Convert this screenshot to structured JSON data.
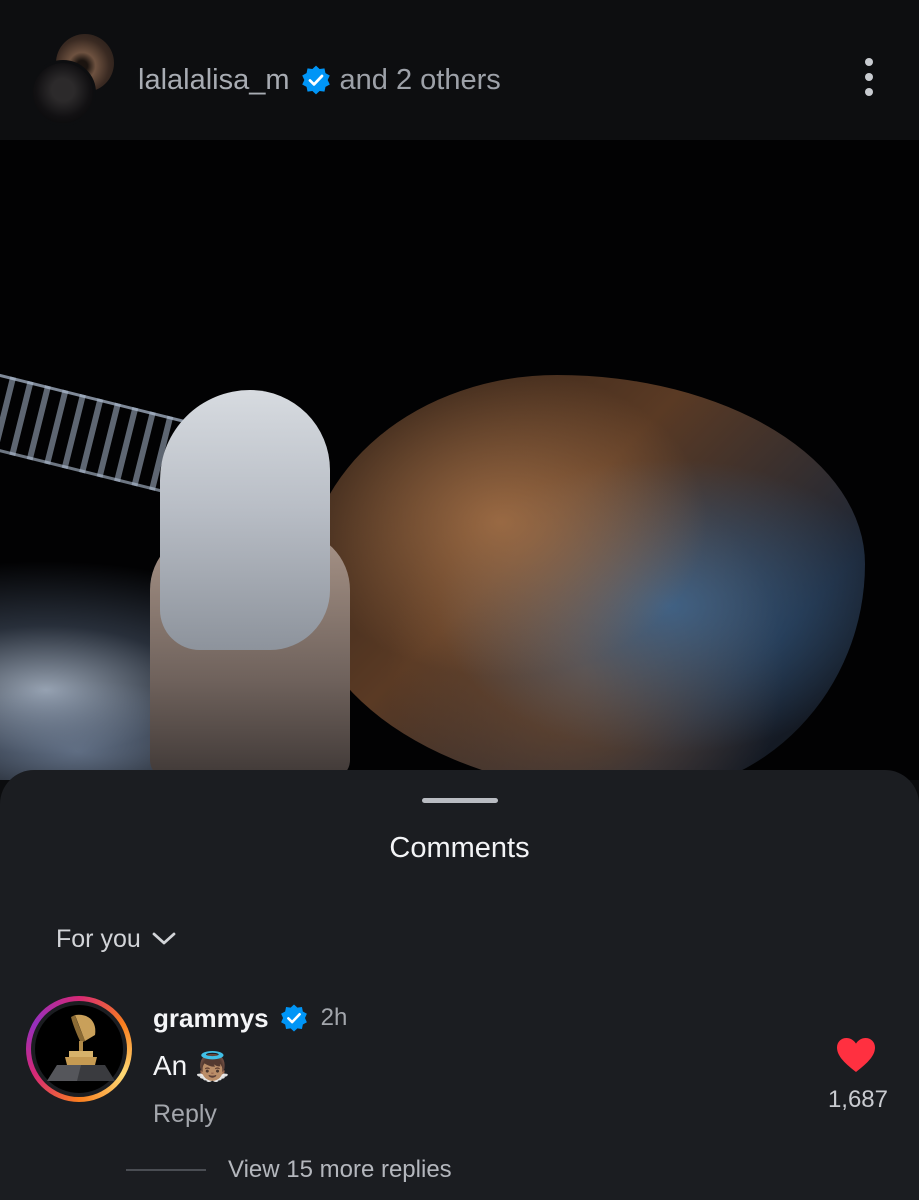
{
  "header": {
    "author": "lalalalisa_m",
    "coauthors_text": "and 2 others",
    "more_icon": "more-vertical-icon"
  },
  "comments_sheet": {
    "title": "Comments",
    "sort_label": "For you",
    "comments": [
      {
        "username": "grammys",
        "verified": true,
        "time": "2h",
        "text": "An",
        "emoji": "👼🏽",
        "reply_label": "Reply",
        "likes": "1,687",
        "view_replies": "View 15 more replies"
      }
    ]
  },
  "colors": {
    "verified_blue": "#0095f6",
    "like_red": "#ff3040",
    "sheet_bg": "#1b1d21"
  }
}
